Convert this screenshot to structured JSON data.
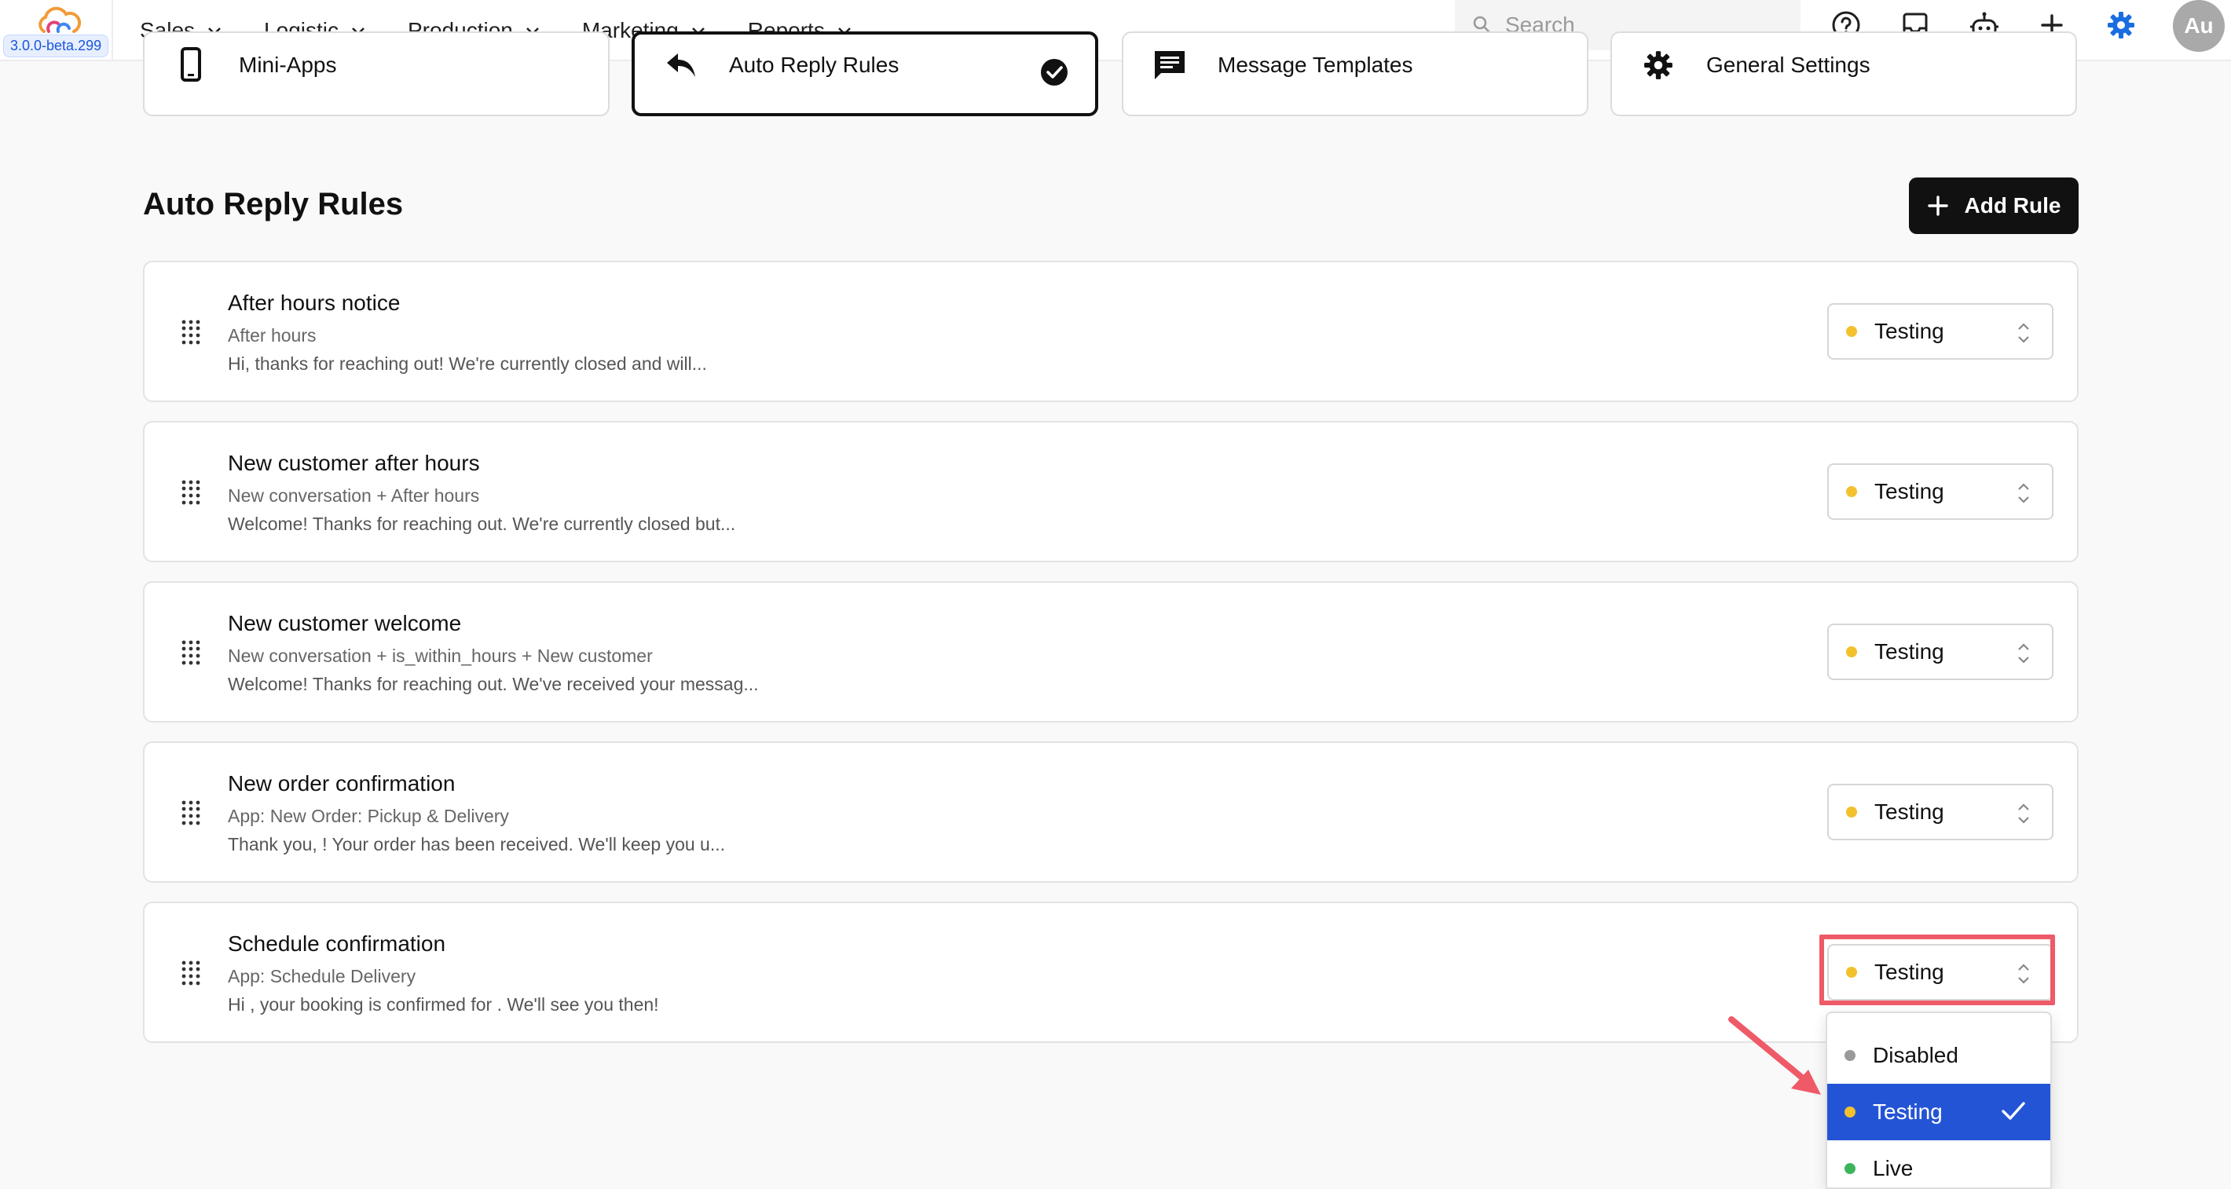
{
  "app": {
    "version": "3.0.0-beta.299"
  },
  "nav": {
    "items": [
      {
        "label": "Sales"
      },
      {
        "label": "Logistic"
      },
      {
        "label": "Production"
      },
      {
        "label": "Marketing"
      },
      {
        "label": "Reports"
      }
    ],
    "search_placeholder": "Search",
    "icons": [
      "help-icon",
      "inbox-icon",
      "bot-icon",
      "plus-icon",
      "gear-icon"
    ],
    "avatar_initials": "Au",
    "accent_color": "#1a6de0"
  },
  "tabs": [
    {
      "label": "Mini-Apps",
      "icon": "phone-icon"
    },
    {
      "label": "Auto Reply Rules",
      "icon": "reply-icon",
      "active": true
    },
    {
      "label": "Message Templates",
      "icon": "message-icon"
    },
    {
      "label": "General Settings",
      "icon": "gear-icon"
    }
  ],
  "page": {
    "title": "Auto Reply Rules",
    "add_button_label": "Add Rule"
  },
  "rules": [
    {
      "title": "After hours notice",
      "trigger": "After hours",
      "preview": "Hi, thanks for reaching out! We're currently closed and will...",
      "status": "Testing"
    },
    {
      "title": "New customer after hours",
      "trigger": "New conversation + After hours",
      "preview": "Welcome! Thanks for reaching out. We're currently closed but...",
      "status": "Testing"
    },
    {
      "title": "New customer welcome",
      "trigger": "New conversation + is_within_hours + New customer",
      "preview": "Welcome! Thanks for reaching out. We've received your messag...",
      "status": "Testing"
    },
    {
      "title": "New order confirmation",
      "trigger": "App: New Order: Pickup & Delivery",
      "preview": "Thank you, ! Your order has been received. We'll keep you u...",
      "status": "Testing"
    },
    {
      "title": "Schedule confirmation",
      "trigger": "App: Schedule Delivery",
      "preview": "Hi , your booking is confirmed for . We'll see you then!",
      "status": "Testing"
    }
  ],
  "status_dropdown": {
    "options": [
      {
        "label": "Disabled",
        "color": "#9a9a9a"
      },
      {
        "label": "Testing",
        "color": "#f2c12e",
        "selected": true
      },
      {
        "label": "Live",
        "color": "#3cb55a"
      }
    ]
  },
  "status_colors": {
    "testing": "#f2c12e",
    "disabled": "#9a9a9a",
    "live": "#3cb55a"
  },
  "annotation_color": "#ef5a68"
}
